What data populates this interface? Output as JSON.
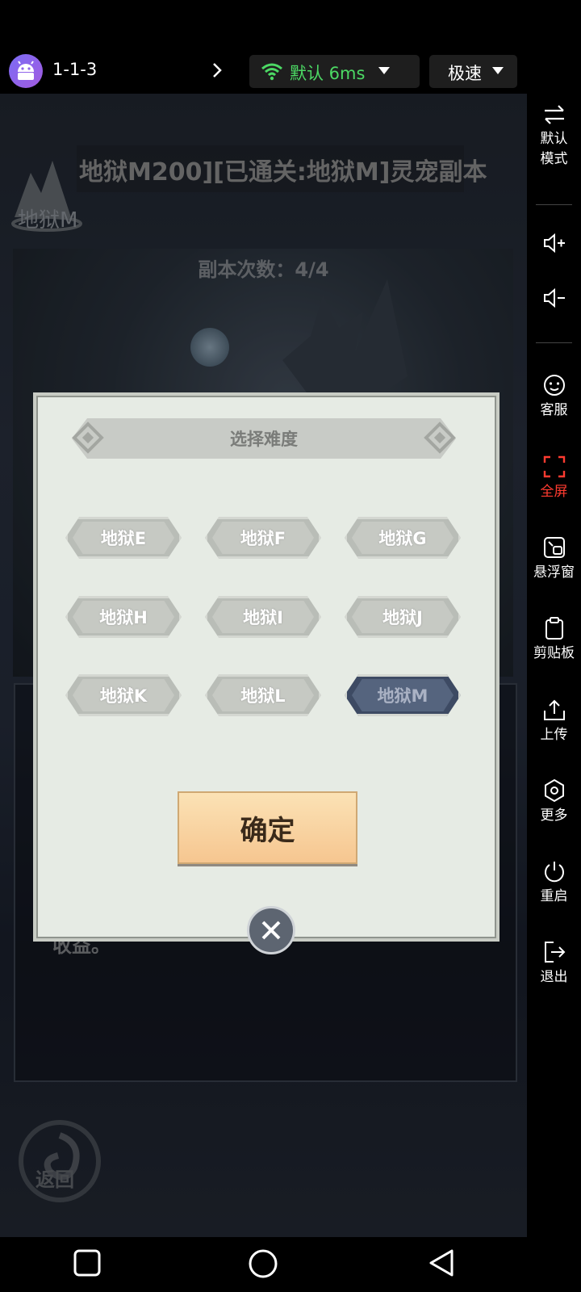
{
  "topbar": {
    "device_id": "1-1-3",
    "network_label": "默认 6ms",
    "speed_label": "极速",
    "colors": {
      "network": "#4cd964",
      "avatar": "#8e64ea"
    }
  },
  "game": {
    "header_title": "地狱M200][已通关:地狱M]灵宠副本",
    "logo_text": "地狱M",
    "dungeon_count": "副本次数：4/4",
    "lower_text": "收益。",
    "back_label": "返回"
  },
  "modal": {
    "title": "选择难度",
    "difficulties": [
      {
        "label": "地狱E",
        "selected": false
      },
      {
        "label": "地狱F",
        "selected": false
      },
      {
        "label": "地狱G",
        "selected": false
      },
      {
        "label": "地狱H",
        "selected": false
      },
      {
        "label": "地狱I",
        "selected": false
      },
      {
        "label": "地狱J",
        "selected": false
      },
      {
        "label": "地狱K",
        "selected": false
      },
      {
        "label": "地狱L",
        "selected": false
      },
      {
        "label": "地狱M",
        "selected": true
      }
    ],
    "confirm_label": "确定"
  },
  "sidebar": {
    "items": [
      {
        "label": "默认\n模式",
        "icon": "swap-icon"
      },
      {
        "label": "",
        "icon": "volume-up-icon"
      },
      {
        "label": "",
        "icon": "volume-down-icon"
      },
      {
        "label": "客服",
        "icon": "support-icon"
      },
      {
        "label": "全屏",
        "icon": "fullscreen-icon",
        "active": true
      },
      {
        "label": "悬浮窗",
        "icon": "float-window-icon"
      },
      {
        "label": "剪贴板",
        "icon": "clipboard-icon"
      },
      {
        "label": "上传",
        "icon": "upload-icon"
      },
      {
        "label": "更多",
        "icon": "more-icon"
      },
      {
        "label": "重启",
        "icon": "restart-icon"
      },
      {
        "label": "退出",
        "icon": "exit-icon"
      }
    ],
    "active_color": "#ff3b30"
  },
  "navbar": {
    "buttons": [
      "recents",
      "home",
      "back"
    ]
  }
}
